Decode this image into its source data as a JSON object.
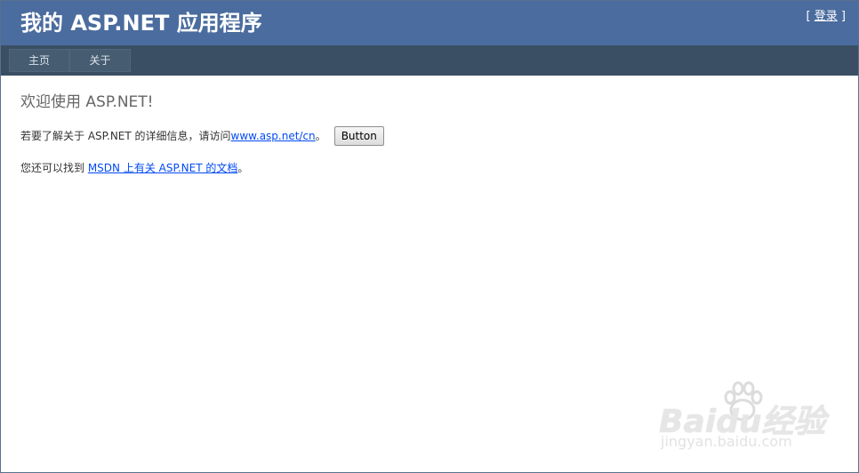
{
  "header": {
    "title": "我的 ASP.NET 应用程序",
    "login_open": "[ ",
    "login_label": "登录",
    "login_close": " ]"
  },
  "nav": {
    "items": [
      {
        "label": "主页"
      },
      {
        "label": "关于"
      }
    ]
  },
  "main": {
    "heading": "欢迎使用 ASP.NET!",
    "info_text": "若要了解关于 ASP.NET 的详细信息，请访问 ",
    "info_link": "www.asp.net/cn",
    "info_suffix": "。",
    "button_label": "Button",
    "docs_text": "您还可以找到 ",
    "docs_link": "MSDN 上有关 ASP.NET 的文档",
    "docs_suffix": "。"
  },
  "watermark": {
    "logo": "Baidu经验",
    "url": "jingyan.baidu.com"
  },
  "colors": {
    "header_bg": "#4b6c9e",
    "nav_bg": "#3a4f63",
    "link": "#034af3"
  }
}
